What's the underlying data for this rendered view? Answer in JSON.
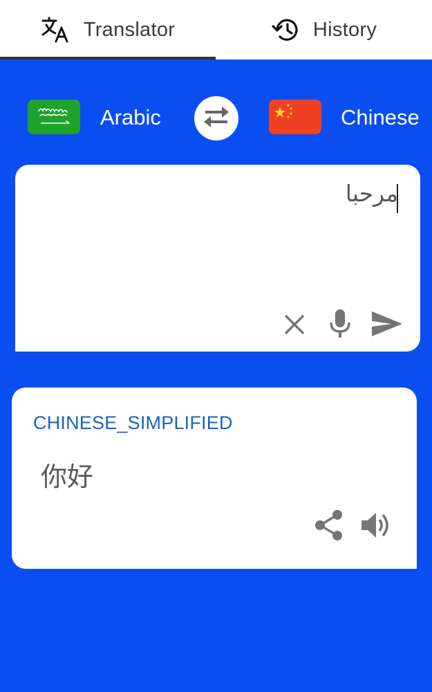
{
  "tabs": [
    {
      "label": "Translator",
      "icon": "translate-icon",
      "active": true
    },
    {
      "label": "History",
      "icon": "history-icon",
      "active": false
    }
  ],
  "languages": {
    "source": {
      "name": "Arabic",
      "flag": "saudi-arabia-flag"
    },
    "target": {
      "name": "Chinese",
      "flag": "china-flag"
    }
  },
  "input": {
    "text": "مرحبا"
  },
  "output": {
    "language_code": "CHINESE_SIMPLIFIED",
    "text": "你好"
  },
  "colors": {
    "background": "#0a4ef2",
    "accent_text": "#1565c0",
    "flag_sa": "#1fa22e",
    "flag_cn": "#ef4225"
  }
}
